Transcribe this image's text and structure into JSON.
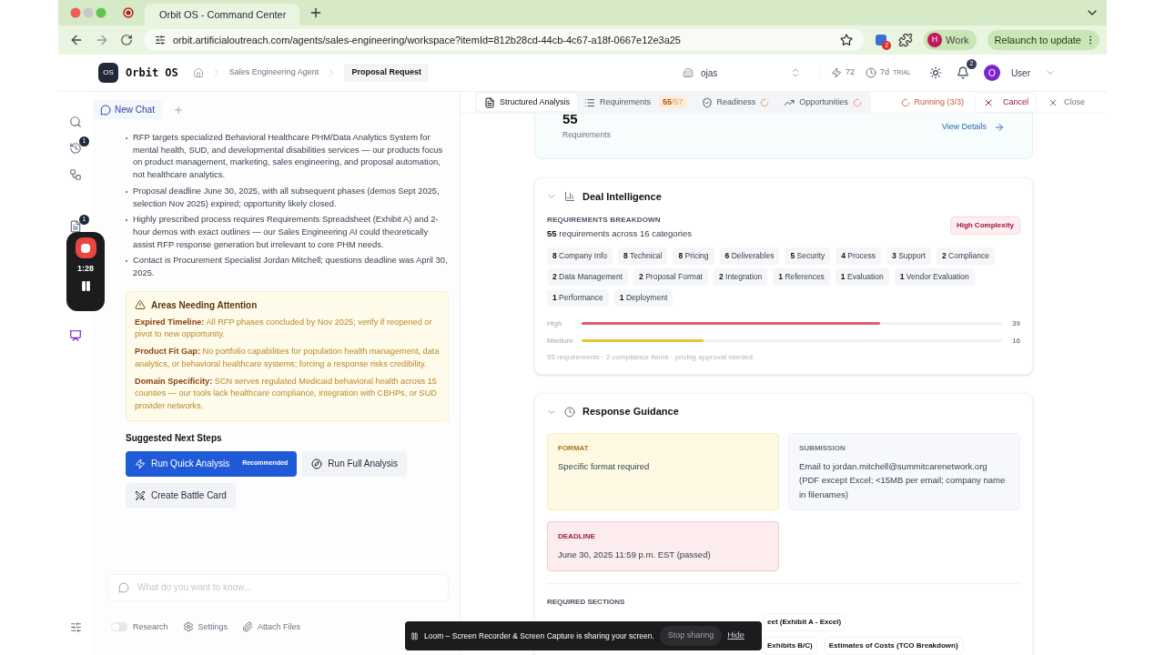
{
  "browser": {
    "tab_title": "Orbit OS - Command Center",
    "url": "orbit.artificialoutreach.com/agents/sales-engineering/workspace?itemId=812b28cd-44cb-4c67-a18f-0667e12e3a25",
    "extension_badge": "2",
    "profile": {
      "initial": "H",
      "label": "Work"
    },
    "relaunch": "Relaunch to update"
  },
  "header": {
    "logo_mark": "OS",
    "brand": "Orbit OS",
    "breadcrumb": [
      {
        "label": "Sales Engineering Agent",
        "selected": false
      },
      {
        "label": "Proposal Request",
        "selected": true
      }
    ],
    "workspace": "ojas",
    "credits": "72",
    "trial_days": "7d",
    "trial_label": "TRIAL",
    "notifications": "2",
    "avatar": "O",
    "user": "User"
  },
  "rail": [
    {
      "selected": false
    },
    {
      "badge": "1",
      "selected": false
    },
    {
      "selected": false
    },
    {
      "badge": "1",
      "selected": false
    },
    {
      "selected": true
    }
  ],
  "recorder": {
    "time": "1:28"
  },
  "chat": {
    "tab": "New Chat",
    "bullets": [
      "RFP targets specialized Behavioral Healthcare PHM/Data Analytics System for mental health, SUD, and developmental disabilities services — our products focus on product management, marketing, sales engineering, and proposal automation, not healthcare analytics.",
      "Proposal deadline June 30, 2025, with all subsequent phases (demos Sept 2025, selection Nov 2025) expired; opportunity likely closed.",
      "Highly prescribed process requires Requirements Spreadsheet (Exhibit A) and 2-hour demos with exact outlines — our Sales Engineering AI could theoretically assist RFP response generation but irrelevant to core PHM needs.",
      "Contact is Procurement Specialist Jordan Mitchell; questions deadline was April 30, 2025."
    ],
    "attention": {
      "title": "Areas Needing Attention",
      "items": [
        {
          "label": "Expired Timeline:",
          "text": "All RFP phases concluded by Nov 2025; verify if reopened or pivot to new opportunity."
        },
        {
          "label": "Product Fit Gap:",
          "text": "No portfolio capabilities for population health management, data analytics, or behavioral healthcare systems; forcing a response risks credibility."
        },
        {
          "label": "Domain Specificity:",
          "text": "SCN serves regulated Medicaid behavioral health across 15 counties — our tools lack healthcare compliance, integration with CBHPs, or SUD provider networks."
        }
      ]
    },
    "next_steps": {
      "title": "Suggested Next Steps",
      "actions": [
        {
          "label": "Run Quick Analysis",
          "badge": "Recommended",
          "primary": true
        },
        {
          "label": "Run Full Analysis",
          "primary": false
        },
        {
          "label": "Create Battle Card",
          "primary": false
        }
      ]
    },
    "input": {
      "placeholder": "What do you want to know..."
    },
    "toolbar": {
      "research": {
        "label": "Research",
        "on": false
      },
      "settings": "Settings",
      "attach": "Attach Files"
    }
  },
  "analysis": {
    "tabs": [
      {
        "label": "Structured Analysis",
        "selected": true,
        "loading": false
      },
      {
        "label": "Requirements",
        "count": "55",
        "total": "/67",
        "selected": false,
        "loading": false
      },
      {
        "label": "Readiness",
        "selected": false,
        "loading": true
      },
      {
        "label": "Opportunities",
        "selected": false,
        "loading": true
      }
    ],
    "status": "Running (3/3)",
    "cancel": "Cancel",
    "close": "Close",
    "summary": {
      "value": "55",
      "label": "Requirements",
      "link": "View Details"
    },
    "deal": {
      "title": "Deal Intelligence",
      "expanded": true,
      "section": "REQUIREMENTS BREAKDOWN",
      "count": "55",
      "count_text": "requirements across 16 categories",
      "badge": "High Complexity",
      "categories": [
        {
          "count": "8",
          "label": "Company Info"
        },
        {
          "count": "8",
          "label": "Technical"
        },
        {
          "count": "8",
          "label": "Pricing"
        },
        {
          "count": "6",
          "label": "Deliverables"
        },
        {
          "count": "5",
          "label": "Security"
        },
        {
          "count": "4",
          "label": "Process"
        },
        {
          "count": "3",
          "label": "Support"
        },
        {
          "count": "2",
          "label": "Compliance"
        },
        {
          "count": "2",
          "label": "Data Management"
        },
        {
          "count": "2",
          "label": "Proposal Format"
        },
        {
          "count": "2",
          "label": "Integration"
        },
        {
          "count": "1",
          "label": "References"
        },
        {
          "count": "1",
          "label": "Evaluation"
        },
        {
          "count": "1",
          "label": "Vendor Evaluation"
        },
        {
          "count": "1",
          "label": "Performance"
        },
        {
          "count": "1",
          "label": "Deployment"
        }
      ],
      "priorities": [
        {
          "label": "High",
          "level": 0.71,
          "value": "39",
          "color": "#e05d6c"
        },
        {
          "label": "Medium",
          "level": 0.29,
          "value": "16",
          "color": "#e6c435"
        }
      ],
      "footnote": "55 requirements · 2 compliance items · pricing approval needed"
    },
    "guidance": {
      "title": "Response Guidance",
      "expanded": true,
      "boxes": [
        {
          "kind": "format",
          "label": "FORMAT",
          "text": "Specific format required"
        },
        {
          "kind": "submission",
          "label": "SUBMISSION",
          "text": "Email to jordan.mitchell@summitcarenetwork.org (PDF except Excel; <15MB per email; company name in filenames)"
        },
        {
          "kind": "deadline",
          "label": "DEADLINE",
          "text": "June 30, 2025 11:59 p.m. EST (passed)"
        }
      ],
      "required_title": "REQUIRED SECTIONS",
      "required": [
        [
          "eet (Exhibit A - Excel)"
        ],
        [
          "Exhibits B/C)",
          "Estimates of Costs (TCO Breakdown)"
        ]
      ]
    }
  },
  "loom": {
    "message": "Loom – Screen Recorder & Screen Capture is sharing your screen.",
    "stop": "Stop sharing",
    "hide": "Hide"
  }
}
